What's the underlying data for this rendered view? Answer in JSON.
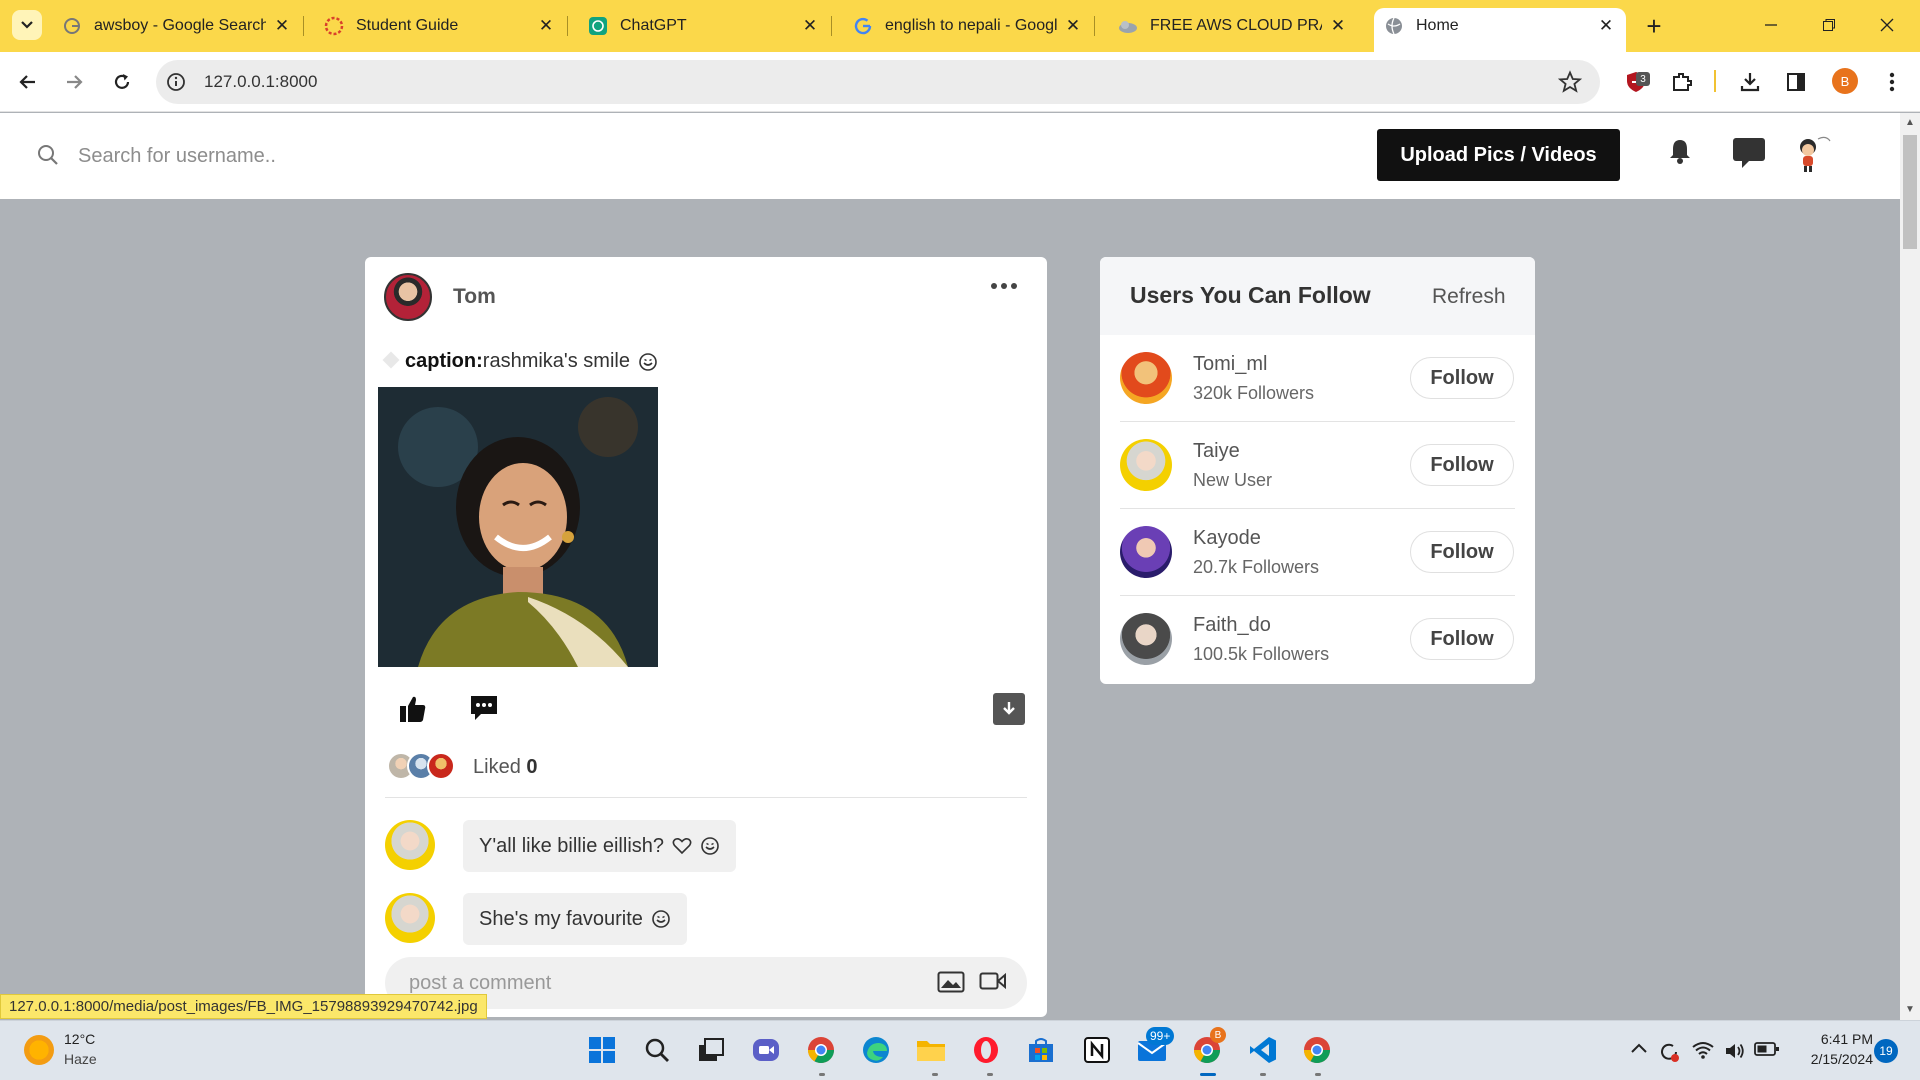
{
  "browser": {
    "tabs": [
      {
        "title": "awsboy - Google Search",
        "icon": "google-icon"
      },
      {
        "title": "Student Guide",
        "icon": "student-guide-icon"
      },
      {
        "title": "ChatGPT",
        "icon": "chatgpt-icon"
      },
      {
        "title": "english to nepali - Googl",
        "icon": "google-icon"
      },
      {
        "title": "FREE AWS CLOUD PRACT",
        "icon": "aws-course-icon"
      },
      {
        "title": "Home",
        "icon": "globe-icon",
        "active": true
      }
    ],
    "url": "127.0.0.1:8000",
    "extension_badge": "3",
    "profile_initial": "B"
  },
  "header": {
    "search_placeholder": "Search for username..",
    "upload_label": "Upload Pics / Videos"
  },
  "post": {
    "author": "Tom",
    "caption_label": "caption:",
    "caption_text": "rashmika's smile",
    "liked_label": "Liked",
    "liked_count": "0",
    "comments": [
      {
        "text": "Y'all like billie eillish?"
      },
      {
        "text": "She's my favourite"
      }
    ],
    "comment_placeholder": "post a comment"
  },
  "suggestions": {
    "title": "Users You Can Follow",
    "refresh_label": "Refresh",
    "follow_label": "Follow",
    "users": [
      {
        "name": "Tomi_ml",
        "sub": "320k Followers"
      },
      {
        "name": "Taiye",
        "sub": "New User"
      },
      {
        "name": "Kayode",
        "sub": "20.7k Followers"
      },
      {
        "name": "Faith_do",
        "sub": "100.5k Followers"
      }
    ]
  },
  "status_url": "127.0.0.1:8000/media/post_images/FB_IMG_15798893929470742.jpg",
  "taskbar": {
    "weather_temp": "12°C",
    "weather_desc": "Haze",
    "mail_badge": "99+",
    "chrome_badge": "B",
    "time": "6:41 PM",
    "date": "2/15/2024",
    "notification_count": "19"
  },
  "colors": {
    "tabstrip": "#fbd84a",
    "page_bg": "#aeb2b7",
    "upload_button": "#111111",
    "profile": "#e8731c"
  }
}
